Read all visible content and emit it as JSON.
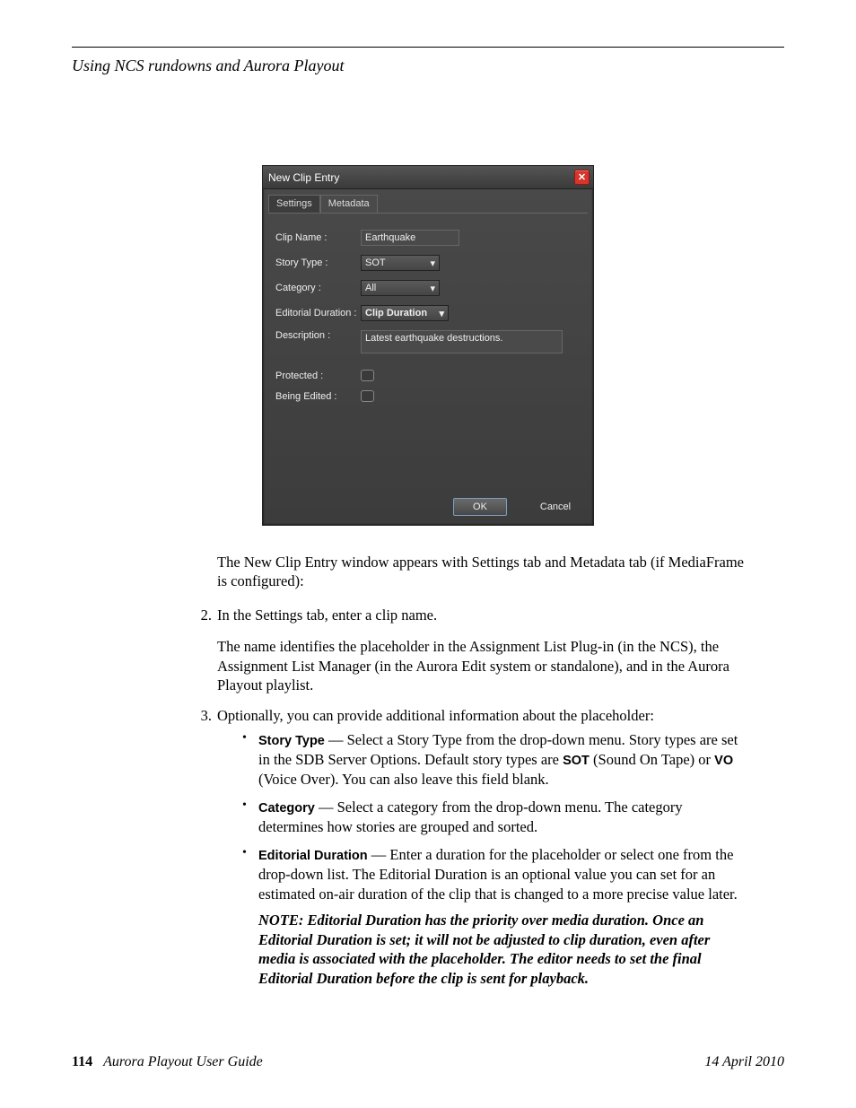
{
  "header": {
    "section_title": "Using NCS rundowns and Aurora Playout"
  },
  "dialog": {
    "title": "New Clip Entry",
    "tabs": {
      "settings": "Settings",
      "metadata": "Metadata"
    },
    "labels": {
      "clip_name": "Clip Name :",
      "story_type": "Story Type :",
      "category": "Category :",
      "editorial_duration": "Editorial Duration :",
      "description": "Description :",
      "protected": "Protected :",
      "being_edited": "Being Edited :"
    },
    "values": {
      "clip_name": "Earthquake",
      "story_type": "SOT",
      "category": "All",
      "editorial_duration": "Clip Duration",
      "description": "Latest earthquake destructions."
    },
    "buttons": {
      "ok": "OK",
      "cancel": "Cancel"
    }
  },
  "paragraphs": {
    "intro": "The New Clip Entry window appears with Settings tab and Metadata tab (if MediaFrame is configured):",
    "step2_num": "2.",
    "step2": "In the Settings tab, enter a clip name.",
    "step2_detail": "The name identifies the placeholder in the Assignment List Plug-in (in the NCS), the Assignment List Manager (in the Aurora Edit system or standalone), and in the Aurora Playout playlist.",
    "step3_num": "3.",
    "step3": "Optionally, you can provide additional information about the placeholder:",
    "bullets": {
      "story_type_term": "Story Type",
      "story_type_text_a": " — Select a Story Type from the drop-down menu. Story types are set in the SDB Server Options. Default story types are ",
      "sot": "SOT",
      "story_type_text_b": " (Sound On Tape) or ",
      "vo": "VO",
      "story_type_text_c": " (Voice Over). You can also leave this field blank.",
      "category_term": "Category",
      "category_text": " — Select a category from the drop-down menu. The category determines how stories are grouped and sorted.",
      "editorial_term": "Editorial Duration",
      "editorial_text": " — Enter a duration for the placeholder or select one from the drop-down list. The Editorial Duration is an optional value you can set for an estimated on-air duration of the clip that is changed to a more precise value later."
    },
    "note_label": "NOTE:  ",
    "note_text": "Editorial Duration has the priority over media duration. Once an Editorial Duration is set; it will not be adjusted to clip duration, even after media is associated with the placeholder. The editor needs to set the final Editorial Duration before the clip is sent for playback."
  },
  "footer": {
    "page_num": "114",
    "guide": "Aurora Playout User Guide",
    "date": "14 April 2010"
  }
}
